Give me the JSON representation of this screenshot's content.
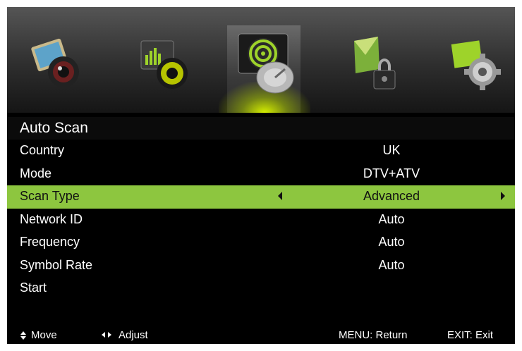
{
  "top_icons": [
    {
      "name": "picture-icon",
      "selected": false
    },
    {
      "name": "sound-icon",
      "selected": false
    },
    {
      "name": "channel-icon",
      "selected": true
    },
    {
      "name": "lock-icon",
      "selected": false
    },
    {
      "name": "setup-icon",
      "selected": false
    }
  ],
  "menu": {
    "title": "Auto Scan",
    "rows": [
      {
        "label": "Country",
        "value": "UK"
      },
      {
        "label": "Mode",
        "value": "DTV+ATV"
      },
      {
        "label": "Scan Type",
        "value": "Advanced"
      },
      {
        "label": "Network ID",
        "value": "Auto"
      },
      {
        "label": "Frequency",
        "value": "Auto"
      },
      {
        "label": "Symbol Rate",
        "value": "Auto"
      },
      {
        "label": "Start",
        "value": ""
      }
    ],
    "selected_row": "Scan Type"
  },
  "footer": {
    "move": "Move",
    "adjust": "Adjust",
    "menu_return": "MENU: Return",
    "exit": "EXIT: Exit"
  },
  "colors": {
    "highlight": "#8dc63f",
    "background": "#000000",
    "accent_glow": "#d6f000"
  }
}
